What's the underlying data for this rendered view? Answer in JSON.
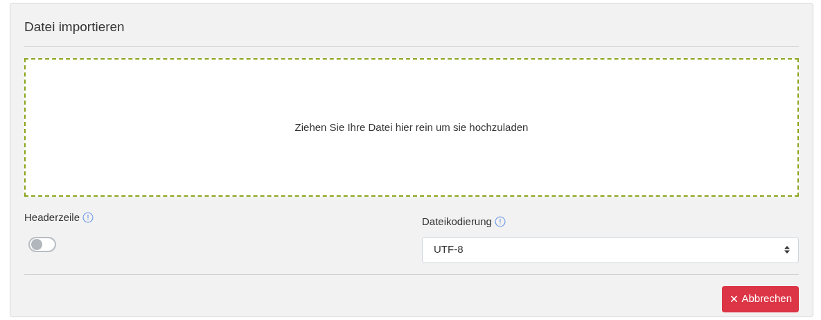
{
  "title": "Datei importieren",
  "dropzone": {
    "text": "Ziehen Sie Ihre Datei hier rein um sie hochzuladen"
  },
  "header_row": {
    "label": "Headerzeile",
    "on": false
  },
  "encoding": {
    "label": "Dateikodierung",
    "value": "UTF-8"
  },
  "buttons": [
    {
      "label": "Abbrechen",
      "kind": "cancel"
    }
  ]
}
